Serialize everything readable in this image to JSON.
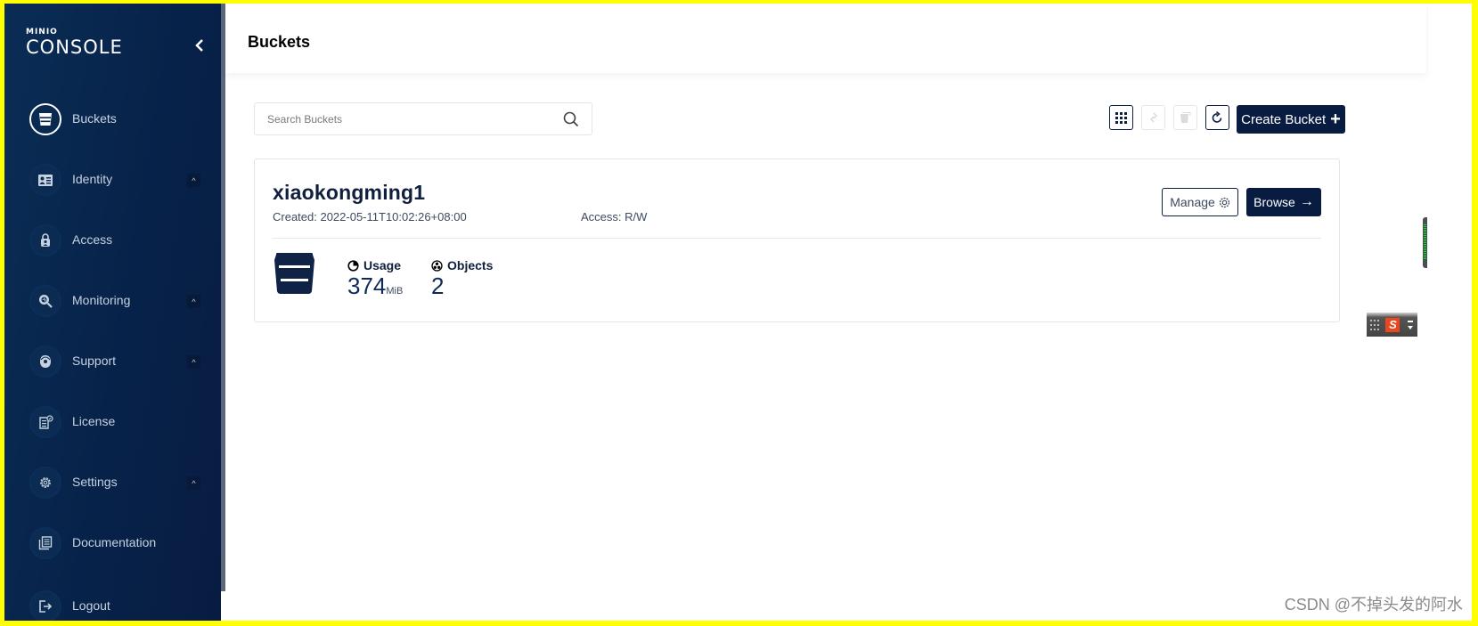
{
  "app": {
    "logo_top": "MINIO",
    "logo_bottom": "CONSOLE"
  },
  "sidebar": {
    "items": [
      {
        "label": "Buckets",
        "icon": "bucket-icon",
        "active": true,
        "expandable": false
      },
      {
        "label": "Identity",
        "icon": "id-card-icon",
        "active": false,
        "expandable": true
      },
      {
        "label": "Access",
        "icon": "lock-user-icon",
        "active": false,
        "expandable": false
      },
      {
        "label": "Monitoring",
        "icon": "monitor-search-icon",
        "active": false,
        "expandable": true
      },
      {
        "label": "Support",
        "icon": "support-head-icon",
        "active": false,
        "expandable": true
      },
      {
        "label": "License",
        "icon": "license-icon",
        "active": false,
        "expandable": false
      },
      {
        "label": "Settings",
        "icon": "gear-icon",
        "active": false,
        "expandable": true
      },
      {
        "label": "Documentation",
        "icon": "documents-icon",
        "active": false,
        "expandable": false
      },
      {
        "label": "Logout",
        "icon": "logout-icon",
        "active": false,
        "expandable": false
      }
    ],
    "caret": "^",
    "collapse_glyph": "‹"
  },
  "header": {
    "title": "Buckets"
  },
  "search": {
    "placeholder": "Search Buckets",
    "value": ""
  },
  "toolbar": {
    "create_bucket_label": "Create Bucket",
    "create_bucket_glyph": "+"
  },
  "bucket": {
    "name": "xiaokongming1",
    "created": "Created: 2022-05-11T10:02:26+08:00",
    "access": "Access: R/W",
    "manage_label": "Manage",
    "browse_label": "Browse",
    "browse_glyph": "→",
    "usage_label": "Usage",
    "usage_value": "374",
    "usage_unit": "MiB",
    "objects_label": "Objects",
    "objects_value": "2"
  },
  "colors": {
    "brand_dark": "#081c42",
    "sidebar_bg": "#072249",
    "ime_red": "#e9471e"
  },
  "watermark": "CSDN @不掉头发的阿水"
}
